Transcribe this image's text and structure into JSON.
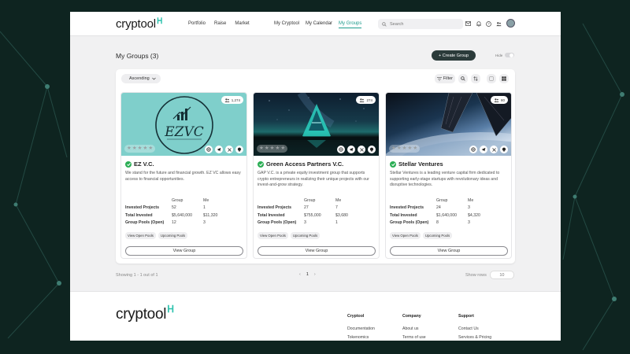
{
  "header": {
    "logo": "cryptool",
    "nav_left": [
      "Portfolio",
      "Raise",
      "Market"
    ],
    "nav_right": [
      {
        "label": "My Cryptool",
        "active": false
      },
      {
        "label": "My Calendar",
        "active": false
      },
      {
        "label": "My Groups",
        "active": true
      }
    ],
    "search": {
      "placeholder": "Search"
    },
    "icons": [
      "mail-icon",
      "bell-icon",
      "help-icon",
      "people-icon",
      "avatar"
    ]
  },
  "page": {
    "title": "My Groups (3)",
    "create_button": "+ Create Group",
    "hide_label": "Hide",
    "sort_value": "Ascending",
    "filter_label": "Filter"
  },
  "cards": [
    {
      "name": "EZ V.C.",
      "members": "1,274",
      "rating": 5,
      "description": "We stand for the future and financial growth. EZ VC allows easy access to financial opportunities.",
      "image_text": "EZVC",
      "stats": {
        "col_group": "Group",
        "col_me": "Me",
        "invested_projects_label": "Invested Projects",
        "invested_projects_group": "52",
        "invested_projects_me": "1",
        "total_invested_label": "Total Invested",
        "total_invested_group": "$5,640,000",
        "total_invested_me": "$11,320",
        "group_pools_label": "Group Pools (Open)",
        "group_pools_group": "12",
        "group_pools_me": "3"
      },
      "pill_open": "View Open Pools",
      "pill_upcoming": "Upcoming Pools",
      "view_button": "View Group"
    },
    {
      "name": "Green Access Partners V.C.",
      "members": "274",
      "rating": 5,
      "description": "GAP V.C. is a private equity investment group that supports crypto entrepreneurs in realizing their unique projects with our invest-and-grow strategy.",
      "stats": {
        "col_group": "Group",
        "col_me": "Me",
        "invested_projects_label": "Invested Projects",
        "invested_projects_group": "27",
        "invested_projects_me": "7",
        "total_invested_label": "Total Invested",
        "total_invested_group": "$755,000",
        "total_invested_me": "$3,680",
        "group_pools_label": "Group Pools (Open)",
        "group_pools_group": "3",
        "group_pools_me": "1"
      },
      "pill_open": "View Open Pools",
      "pill_upcoming": "Upcoming Pools",
      "view_button": "View Group"
    },
    {
      "name": "Stellar Ventures",
      "members": "80",
      "rating": 5,
      "description": "Stellar Ventures is a leading venture capital firm dedicated to supporting early-stage startups with revolutionary ideas and disruptive technologies.",
      "stats": {
        "col_group": "Group",
        "col_me": "Me",
        "invested_projects_label": "Invested Projects",
        "invested_projects_group": "24",
        "invested_projects_me": "3",
        "total_invested_label": "Total Invested",
        "total_invested_group": "$1,640,000",
        "total_invested_me": "$4,320",
        "group_pools_label": "Group Pools (Open)",
        "group_pools_group": "8",
        "group_pools_me": "3"
      },
      "pill_open": "View Open Pools",
      "pill_upcoming": "Upcoming Pools",
      "view_button": "View Group"
    }
  ],
  "pagination": {
    "showing": "Showing 1 - 1 out of 1",
    "prev": "‹",
    "current": "1",
    "next": "›",
    "rows_label": "Show rows",
    "rows_value": "10"
  },
  "footer": {
    "logo": "cryptool",
    "col1": {
      "heading": "Cryptool",
      "links": [
        "Documentation",
        "Tokenomics"
      ]
    },
    "col2": {
      "heading": "Company",
      "links": [
        "About us",
        "Terms of use"
      ]
    },
    "col3": {
      "heading": "Support",
      "links": [
        "Contact Us",
        "Services & Pricing"
      ]
    }
  },
  "colors": {
    "accent": "#1e9b8c",
    "logo_mark": "#2bc2ad",
    "create_button_bg": "#2b3b3a",
    "verified": "#2cae55",
    "outer_bg": "#0e2420"
  }
}
